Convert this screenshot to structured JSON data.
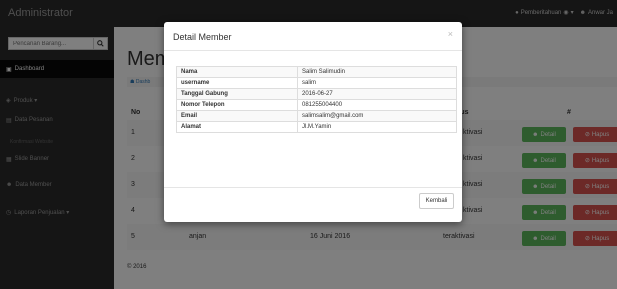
{
  "navbar": {
    "brand": "Administrator",
    "notifications": "Pemberitahuan",
    "user": "Anwar Ja"
  },
  "sidebar": {
    "search_placeholder": "Pencarian Barang...",
    "items": [
      {
        "label": "Dashboard",
        "icon": "dashboard-icon"
      },
      {
        "label": "Produk ▾",
        "icon": "products-icon"
      },
      {
        "label": "Data Pesanan",
        "icon": "orders-icon"
      },
      {
        "label": "Slide Banner",
        "icon": "banner-icon"
      },
      {
        "label": "Data Member",
        "icon": "users-icon"
      },
      {
        "label": "Laporan Penjualan ▾",
        "icon": "report-icon"
      }
    ],
    "sub_item": "Konfirmasi Website"
  },
  "main": {
    "title": "Mem",
    "breadcrumb": "Dashb",
    "table": {
      "headers": [
        "No",
        "tus",
        "#"
      ],
      "rows": [
        {
          "no": "1",
          "name": "",
          "date": "",
          "status": "ktivasi"
        },
        {
          "no": "2",
          "name": "",
          "date": "",
          "status": "ktivasi"
        },
        {
          "no": "3",
          "name": "",
          "date": "",
          "status": "ktivasi"
        },
        {
          "no": "4",
          "name": "",
          "date": "",
          "status": "ktivasi"
        },
        {
          "no": "5",
          "name": "anjan",
          "date": "16 Juni 2016",
          "status": "teraktivasi"
        }
      ],
      "detail_label": "Detail",
      "delete_label": "Hapus"
    },
    "footer": "© 2016"
  },
  "modal": {
    "title": "Detail Member",
    "close": "×",
    "rows": [
      {
        "key": "Nama",
        "value": "Salim Salimudin"
      },
      {
        "key": "username",
        "value": "salim"
      },
      {
        "key": "Tanggal Gabung",
        "value": "2016-06-27"
      },
      {
        "key": "Nomor Telepon",
        "value": "081255004400"
      },
      {
        "key": "Email",
        "value": "salimsalim@gmail.com"
      },
      {
        "key": "Alamat",
        "value": "Jl.M.Yamin"
      }
    ],
    "back_label": "Kembali"
  }
}
